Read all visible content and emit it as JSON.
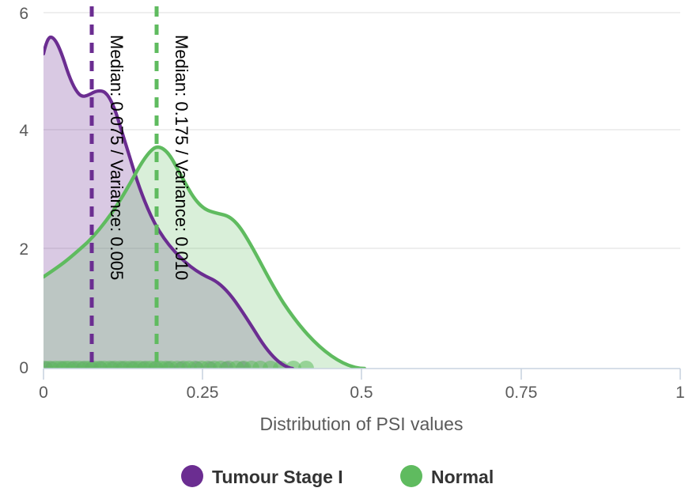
{
  "chart_data": {
    "type": "area",
    "title": "",
    "xlabel": "Distribution of PSI values",
    "ylabel": "",
    "xlim": [
      0,
      1
    ],
    "ylim": [
      0,
      6
    ],
    "xticks": [
      "0",
      "0.25",
      "0.5",
      "0.75",
      "1"
    ],
    "xtick_values": [
      0,
      0.25,
      0.5,
      0.75,
      1
    ],
    "yticks": [
      "0",
      "2",
      "4",
      "6"
    ],
    "ytick_values": [
      0,
      2,
      4,
      6
    ],
    "grid": "horizontal",
    "legend_position": "bottom",
    "series": [
      {
        "name": "Tumour Stage I",
        "color": "#6B2D91",
        "fill": "#6B2D91",
        "fill_opacity": 0.28,
        "median": 0.075,
        "variance": 0.005,
        "annotation": "Median: 0.075 / Variance: 0.005",
        "x": [
          0.0,
          0.012,
          0.025,
          0.038,
          0.05,
          0.062,
          0.075,
          0.088,
          0.1,
          0.112,
          0.125,
          0.138,
          0.15,
          0.162,
          0.175,
          0.19,
          0.205,
          0.22,
          0.235,
          0.25,
          0.265,
          0.28,
          0.295,
          0.31,
          0.325,
          0.345,
          0.365
        ],
        "y": [
          5.28,
          5.68,
          5.3,
          4.85,
          4.62,
          4.64,
          4.74,
          4.78,
          4.45,
          3.9,
          3.3,
          2.8,
          2.4,
          2.05,
          1.7,
          1.42,
          1.24,
          1.16,
          1.05,
          0.82,
          0.6,
          0.4,
          0.25,
          0.14,
          0.07,
          0.03,
          0.0
        ]
      },
      {
        "name": "Normal",
        "color": "#5FBB5F",
        "fill": "#5FBB5F",
        "fill_opacity": 0.25,
        "median": 0.175,
        "variance": 0.01,
        "annotation": "Median: 0.175 / Variance: 0.010",
        "x": [
          0.0,
          0.02,
          0.04,
          0.06,
          0.08,
          0.1,
          0.12,
          0.14,
          0.16,
          0.175,
          0.19,
          0.205,
          0.22,
          0.235,
          0.25,
          0.265,
          0.28,
          0.3,
          0.32,
          0.34,
          0.36,
          0.38,
          0.4,
          0.42,
          0.44,
          0.46,
          0.48,
          0.5,
          0.52
        ],
        "y": [
          1.55,
          1.82,
          2.08,
          2.32,
          2.55,
          2.82,
          3.15,
          3.5,
          3.72,
          3.78,
          3.7,
          3.48,
          3.2,
          2.98,
          2.86,
          2.82,
          2.72,
          2.42,
          2.05,
          1.72,
          1.42,
          1.15,
          0.9,
          0.66,
          0.46,
          0.28,
          0.15,
          0.06,
          0.0
        ]
      }
    ],
    "rug": {
      "description": "rug plot of individual sample PSI values along the baseline",
      "normal_points": [
        0.002,
        0.01,
        0.018,
        0.026,
        0.034,
        0.04,
        0.048,
        0.056,
        0.064,
        0.072,
        0.08,
        0.088,
        0.096,
        0.104,
        0.112,
        0.12,
        0.128,
        0.136,
        0.144,
        0.152,
        0.16,
        0.168,
        0.176,
        0.184,
        0.192,
        0.2,
        0.21,
        0.22,
        0.228,
        0.238,
        0.248,
        0.258,
        0.268,
        0.278,
        0.29,
        0.302,
        0.314,
        0.326,
        0.34,
        0.356,
        0.372,
        0.392,
        0.412
      ],
      "tumour_points": [
        0.004,
        0.014,
        0.03,
        0.046,
        0.062,
        0.076,
        0.09,
        0.108,
        0.124,
        0.14,
        0.158,
        0.176,
        0.196,
        0.216,
        0.24,
        0.262,
        0.286,
        0.312
      ]
    }
  },
  "legend": {
    "items": [
      {
        "label": "Tumour Stage I",
        "color": "#6B2D91"
      },
      {
        "label": "Normal",
        "color": "#5FBB5F"
      }
    ]
  },
  "axis": {
    "x_title": "Distribution of PSI values"
  }
}
